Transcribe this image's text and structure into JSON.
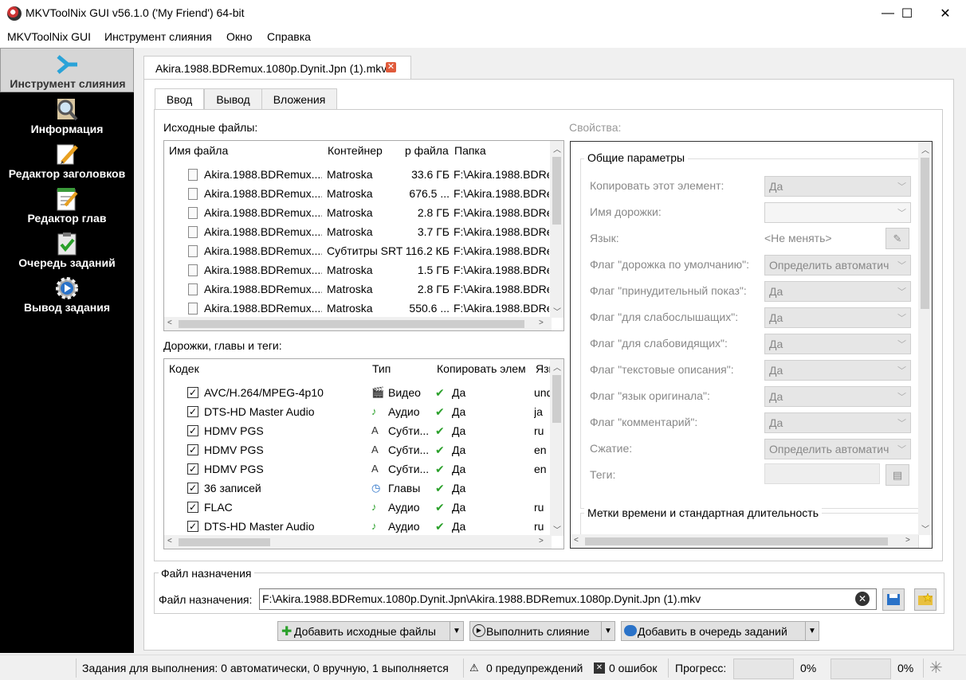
{
  "window": {
    "title": "MKVToolNix GUI v56.1.0 ('My Friend') 64-bit",
    "min": "—",
    "max": "☐",
    "close": "✕"
  },
  "menu": [
    "MKVToolNix GUI",
    "Инструмент слияния",
    "Окно",
    "Справка"
  ],
  "sidebar": [
    {
      "label": "Инструмент слияния",
      "icon": "merge-arrow-icon",
      "active": true
    },
    {
      "label": "Информация",
      "icon": "magnifier-icon"
    },
    {
      "label": "Редактор заголовков",
      "icon": "pencil-icon"
    },
    {
      "label": "Редактор глав",
      "icon": "notepad-icon"
    },
    {
      "label": "Очередь заданий",
      "icon": "clipboard-check-icon"
    },
    {
      "label": "Вывод задания",
      "icon": "gear-icon"
    }
  ],
  "doc_tab": {
    "label": "Akira.1988.BDRemux.1080p.Dynit.Jpn (1).mkv",
    "close": "✕"
  },
  "subtabs": [
    "Ввод",
    "Вывод",
    "Вложения"
  ],
  "source_files": {
    "label": "Исходные файлы:",
    "columns": [
      "Имя файла",
      "Контейнер",
      "р файла",
      "Папка"
    ],
    "rows": [
      [
        "Akira.1988.BDRemux....",
        "Matroska",
        "33.6 ГБ",
        "F:\\Akira.1988.BDRe"
      ],
      [
        "Akira.1988.BDRemux....",
        "Matroska",
        "676.5 ...",
        "F:\\Akira.1988.BDRe"
      ],
      [
        "Akira.1988.BDRemux....",
        "Matroska",
        "2.8 ГБ",
        "F:\\Akira.1988.BDRe"
      ],
      [
        "Akira.1988.BDRemux....",
        "Matroska",
        "3.7 ГБ",
        "F:\\Akira.1988.BDRe"
      ],
      [
        "Akira.1988.BDRemux....",
        "Субтитры SRT",
        "116.2 КБ",
        "F:\\Akira.1988.BDRe"
      ],
      [
        "Akira.1988.BDRemux....",
        "Matroska",
        "1.5 ГБ",
        "F:\\Akira.1988.BDRe"
      ],
      [
        "Akira.1988.BDRemux....",
        "Matroska",
        "2.8 ГБ",
        "F:\\Akira.1988.BDRe"
      ],
      [
        "Akira.1988.BDRemux....",
        "Matroska",
        "550.6 ...",
        "F:\\Akira.1988.BDRe"
      ]
    ]
  },
  "tracks": {
    "label": "Дорожки, главы и теги:",
    "columns": [
      "Кодек",
      "Тип",
      "Копировать элем",
      "Язы"
    ],
    "rows": [
      {
        "codec": "AVC/H.264/MPEG-4p10",
        "type": "Видео",
        "type_icon": "clapper-icon",
        "copy": "Да",
        "lang": "und"
      },
      {
        "codec": "DTS-HD Master Audio",
        "type": "Аудио",
        "type_icon": "music-note-icon",
        "copy": "Да",
        "lang": "ja"
      },
      {
        "codec": "HDMV PGS",
        "type": "Субти...",
        "type_icon": "subtitle-icon",
        "copy": "Да",
        "lang": "ru"
      },
      {
        "codec": "HDMV PGS",
        "type": "Субти...",
        "type_icon": "subtitle-icon",
        "copy": "Да",
        "lang": "en"
      },
      {
        "codec": "HDMV PGS",
        "type": "Субти...",
        "type_icon": "subtitle-icon",
        "copy": "Да",
        "lang": "en"
      },
      {
        "codec": "36 записей",
        "type": "Главы",
        "type_icon": "clock-icon",
        "copy": "Да",
        "lang": ""
      },
      {
        "codec": "FLAC",
        "type": "Аудио",
        "type_icon": "music-note-icon",
        "copy": "Да",
        "lang": "ru"
      },
      {
        "codec": "DTS-HD Master Audio",
        "type": "Аудио",
        "type_icon": "music-note-icon",
        "copy": "Да",
        "lang": "ru"
      }
    ]
  },
  "properties": {
    "label": "Свойства:",
    "group1": "Общие параметры",
    "fields": [
      {
        "label": "Копировать этот элемент:",
        "value": "Да",
        "kind": "combo"
      },
      {
        "label": "Имя дорожки:",
        "value": "",
        "kind": "editcombo"
      },
      {
        "label": "Язык:",
        "value": "<Не менять>",
        "kind": "lang"
      },
      {
        "label": "Флаг \"дорожка по умолчанию\":",
        "value": "Определить автоматич",
        "kind": "combo"
      },
      {
        "label": "Флаг \"принудительный показ\":",
        "value": "Да",
        "kind": "combo"
      },
      {
        "label": "Флаг \"для слабослышащих\":",
        "value": "Да",
        "kind": "combo"
      },
      {
        "label": "Флаг \"для слабовидящих\":",
        "value": "Да",
        "kind": "combo"
      },
      {
        "label": "Флаг \"текстовые описания\":",
        "value": "Да",
        "kind": "combo"
      },
      {
        "label": "Флаг \"язык оригинала\":",
        "value": "Да",
        "kind": "combo"
      },
      {
        "label": "Флаг \"комментарий\":",
        "value": "Да",
        "kind": "combo"
      },
      {
        "label": "Сжатие:",
        "value": "Определить автоматич",
        "kind": "combo"
      },
      {
        "label": "Теги:",
        "value": "",
        "kind": "file"
      }
    ],
    "group2": "Метки времени и стандартная длительность"
  },
  "destination": {
    "group": "Файл назначения",
    "label": "Файл назначения:",
    "value": "F:\\Akira.1988.BDRemux.1080p.Dynit.Jpn\\Akira.1988.BDRemux.1080p.Dynit.Jpn (1).mkv"
  },
  "actions": [
    "Добавить исходные файлы",
    "Выполнить слияние",
    "Добавить в очередь заданий"
  ],
  "status": {
    "jobs": "Задания для выполнения: 0 автоматически, 0 вручную, 1 выполняется",
    "warnings": "0 предупреждений",
    "errors": "0 ошибок",
    "progress_label": "Прогресс:",
    "progress1": "0%",
    "progress2": "0%"
  }
}
